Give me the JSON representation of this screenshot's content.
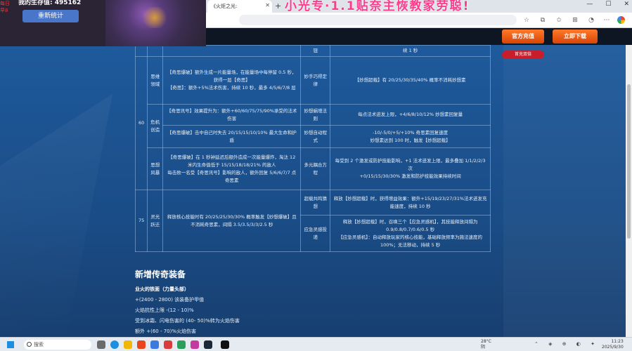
{
  "browser": {
    "tab_title": "《火炬之光:",
    "title_overlay": "小光专·1.1贴奈主恢教家劳聪!",
    "window_controls": [
      "—",
      "☐",
      "✕"
    ]
  },
  "overlay": {
    "survival_label": "我的生存值: 495162",
    "recount_button": "重新统计",
    "left_strip": [
      "每日",
      "早8"
    ]
  },
  "site": {
    "charge_button": "官方充值",
    "download_button": "立即下载",
    "recharge_badge": "首充双倍"
  },
  "table": {
    "top_row": {
      "col3": "钮",
      "col4": "续 1 秒"
    },
    "rows": [
      {
        "level": "60",
        "name": "思维领域",
        "desc": "【奇思爆破】额外生成一片能量场，在能量场中每停留 0.5 秒，获得一层【奇思】\n【奇思】：额外+5%法术伤害，持续 10 秒，最多 4/5/6/7/8 层",
        "ability": "妙手巧得定律",
        "effect": "【妙想超载】有 20/25/30/35/40% 概率不消耗妙想素"
      },
      {
        "name": "危机创造",
        "desc": "【奇思讯号】效果提升为：额外+60/60/75/75/90%承受的法术伤害",
        "ability": "妙想蜗增法则",
        "effect": "每点法术迸发上限，+4/6/8/10/12% 妙想素回复量"
      },
      {
        "desc": "【奇思爆破】击中自己时失去 20/15/15/10/10% 最大生命和护盾",
        "ability": "妙想自动程式",
        "effect": "-10/-5/0/+5/+10% 奇思素回复速度\n妙想素达到 100 时，触发【妙想超载】"
      },
      {
        "name": "思想风暴",
        "desc": "【奇思爆破】在 1 秒钟延迟后额外造成一次能量爆炸，淘汰 12 米内生命值低于 15/15/18/18/21% 的敌人\n每击败一名受【奇思讯号】影响的敌人，额外回复 5/6/6/7/7 点奇思素",
        "ability": "多元耦合方程",
        "effect": "每受到 2 个激发或防护技能影响，+1 法术迸发上限，最多叠加 1/1/2/2/3 次\n+0/15/15/30/30% 激发和防护技能效果持续时间"
      },
      {
        "level": "75",
        "name": "灵光跃迁",
        "desc": "释放核心技能时有 20/25/25/30/30% 概率触发【妙想爆破】且不消耗奇思素，间隔 3.5/3.5/3/3/2.5 秒",
        "ability": "超载共鸣猜想",
        "effect": "释放【妙想超载】时，获得增益效果：额外+15/19/23/27/31%法术迸发充能速度，持续 10 秒"
      },
      {
        "ability": "应急灵感投递",
        "effect": "释放【妙想超载】时，召唤三个【应急灵感机】，其技能释放间隔为 0.9/0.8/0.7/0.6/0.5 秒\n【应急灵感机】：自动释放玩家的核心技能，基础释放频率为施法速度的 100%；无法移动，持续 5 秒"
      }
    ]
  },
  "equipment": {
    "section_title": "新增传奇装备",
    "item_name": "业火的铁面（力量头部）",
    "lines": [
      "+(2400 - 2800) 该装备护甲值",
      "火焰抗性上限 -(12 - 10)%",
      "受到冰霜、闪电伤害的 (40- 50)%转为火焰伤害",
      "额外 +(60 - 70)%火焰伤害"
    ]
  },
  "taskbar": {
    "search_placeholder": "搜索",
    "weather_temp": "28°C",
    "weather_desc": "阴",
    "time": "11:23",
    "date": "2025/9/30"
  },
  "colors": {
    "page_bg": "#1c4f8e",
    "accent_orange": "#e8581a",
    "badge_red": "#c81e2c",
    "title_pink": "#ff3b8d"
  }
}
